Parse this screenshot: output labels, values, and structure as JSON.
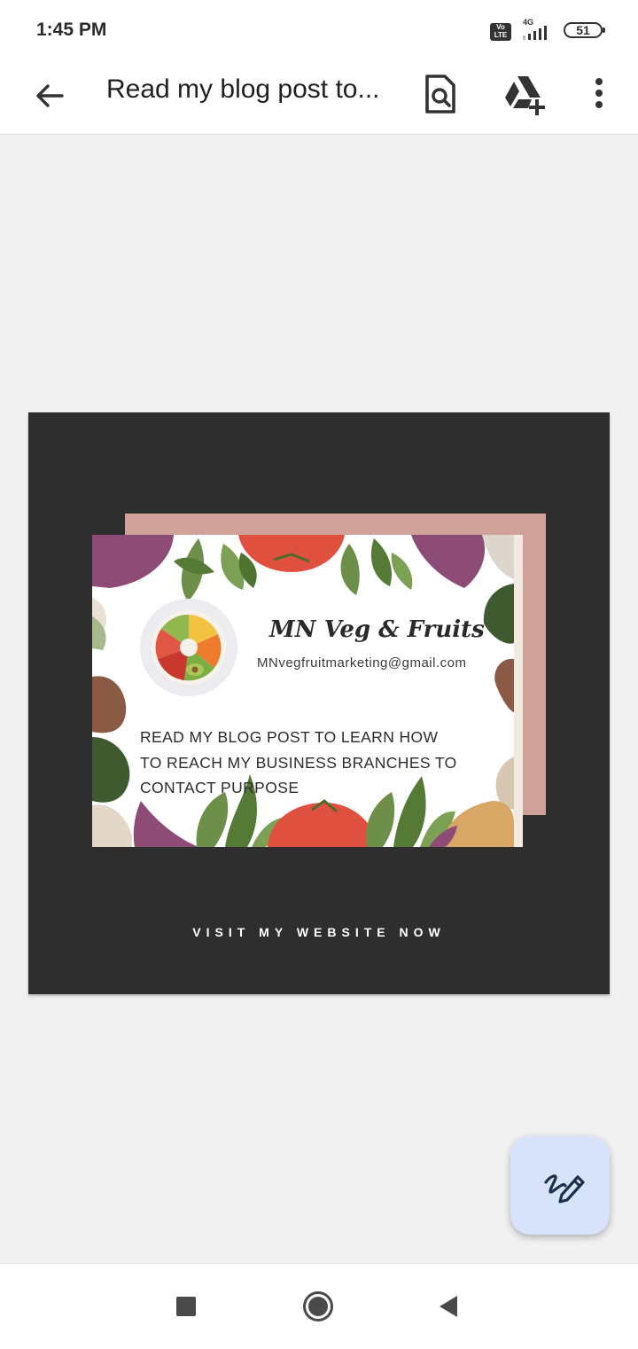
{
  "status_bar": {
    "time": "1:45 PM",
    "volte_label": "Vo LTE",
    "network_label": "4G",
    "battery_level": "51"
  },
  "app_bar": {
    "back_icon": "arrow-back-icon",
    "title": "Read my blog post to...",
    "find_icon": "find-in-page-icon",
    "drive_icon": "add-to-drive-icon",
    "more_icon": "more-vert-icon"
  },
  "preview": {
    "card": {
      "brand_name": "MN Veg & Fruits",
      "email": "MNvegfruitmarketing@gmail.com",
      "message": "READ MY BLOG POST TO LEARN HOW\nTO  REACH MY BUSINESS BRANCHES TO\nCONTACT PURPOSE"
    },
    "cta": "VISIT MY WEBSITE NOW",
    "colors": {
      "background": "#2e2e2e",
      "accent_card": "#cfa39a"
    }
  },
  "fab": {
    "icon": "edit-draw-icon",
    "color": "#d6e3fb"
  },
  "nav_bar": {
    "recents_icon": "square-recents-icon",
    "home_icon": "circle-home-icon",
    "back_icon": "triangle-back-icon"
  }
}
